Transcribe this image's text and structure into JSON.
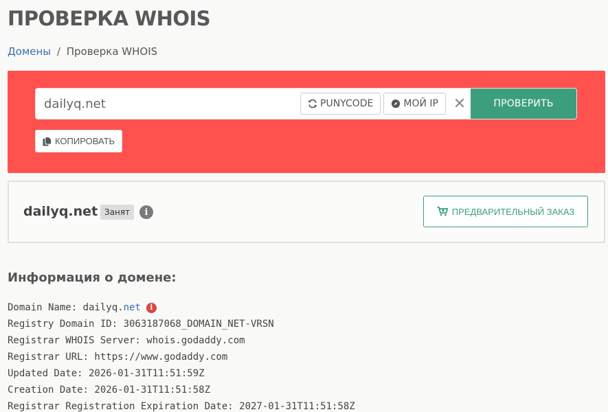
{
  "page": {
    "title": "ПРОВЕРКА WHOIS"
  },
  "breadcrumb": {
    "home": "Домены",
    "separator": "/",
    "current": "Проверка WHOIS"
  },
  "search": {
    "value": "dailyq.net",
    "punycode_label": "PUNYCODE",
    "myip_label": "МОЙ IP",
    "clear_symbol": "✕",
    "submit_label": "ПРОВЕРИТЬ",
    "copy_label": "КОПИРОВАТЬ"
  },
  "result": {
    "domain": "dailyq.net",
    "status": "Занят",
    "info_symbol": "i",
    "preorder_label": "ПРЕДВАРИТЕЛЬНЫЙ ЗАКАЗ"
  },
  "info": {
    "heading": "Информация о домене:",
    "domain_name_label": "Domain Name: ",
    "domain_name_prefix": "dailyq.",
    "domain_name_tld": "net",
    "lines": [
      "Registry Domain ID: 3063187068_DOMAIN_NET-VRSN",
      "Registrar WHOIS Server: whois.godaddy.com",
      "Registrar URL: https://www.godaddy.com",
      "Updated Date: 2026-01-31T11:51:59Z",
      "Creation Date: 2026-01-31T11:51:58Z",
      "Registrar Registration Expiration Date: 2027-01-31T11:51:58Z"
    ]
  },
  "colors": {
    "panel": "#ff524e",
    "accent": "#3d9e7e",
    "link": "#3a6fa8",
    "alert": "#d9453f"
  },
  "icons": [
    "refresh-icon",
    "compass-icon",
    "close-icon",
    "copy-icon",
    "info-icon",
    "cart-icon"
  ]
}
